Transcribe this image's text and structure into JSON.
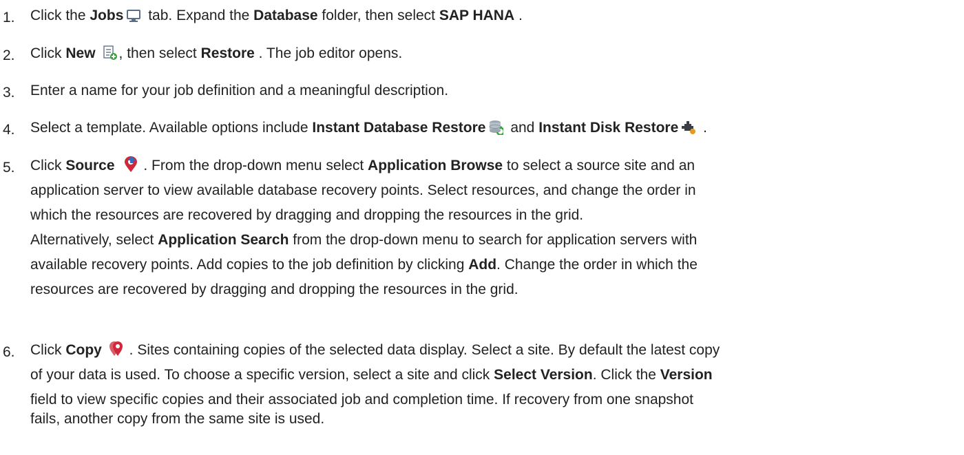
{
  "steps": [
    {
      "number": "1.",
      "t1": "Click the ",
      "b1": "Jobs",
      "t2": " tab. Expand the ",
      "b2": "Database",
      "t3": " folder, then select ",
      "b3": "SAP HANA",
      "t4": " ."
    },
    {
      "number": "2.",
      "t1": "Click ",
      "b1": "New",
      "t2": ", then select ",
      "b2": "Restore",
      "t3": " . The job editor opens."
    },
    {
      "number": "3.",
      "t1": "Enter a name for your job definition and a meaningful description."
    },
    {
      "number": "4.",
      "t1": "Select a template. Available options include ",
      "b1": "Instant Database Restore",
      "t2": " and ",
      "b2": "Instant Disk Restore",
      "t3": " ."
    },
    {
      "number": "5.",
      "l1_t1": "Click ",
      "l1_b1": "Source",
      "l1_t2": " . From the drop-down menu select ",
      "l1_b2": "Application Browse",
      "l1_t3": " to select a source site and an",
      "l2": "application server to view available database recovery points. Select resources, and change the order in",
      "l3": "which the resources are recovered by dragging and dropping the resources in the grid.",
      "p2_l1_t1": "Alternatively, select ",
      "p2_l1_b1": "Application Search",
      "p2_l1_t2": " from the drop-down menu to search for application servers with",
      "p2_l2_t1": "available recovery points. Add copies to the job definition by clicking ",
      "p2_l2_b1": "Add",
      "p2_l2_t2": ". Change the order in which the",
      "p2_l3": "resources are recovered by dragging and dropping the resources in the grid."
    },
    {
      "number": "6.",
      "l1_t1": "Click ",
      "l1_b1": "Copy",
      "l1_t2": " . Sites containing copies of the selected data display. Select a site. By default the latest copy",
      "l2_t1": "of your data is used. To choose a specific version, select a site and click ",
      "l2_b1": "Select Version",
      "l2_t2": ". Click the ",
      "l2_b2": "Version",
      "l3": "field to view specific copies and their associated job and completion time. If recovery from one snapshot",
      "l4": "fails, another copy from the same site is used."
    }
  ],
  "icons": [
    "monitor-icon",
    "new-job-icon",
    "database-restore-icon",
    "disk-restore-icon",
    "source-site-icon",
    "copy-location-icon"
  ],
  "colors": {
    "text": "#222222",
    "icon_green": "#3aa03a",
    "icon_red": "#d0283a"
  }
}
